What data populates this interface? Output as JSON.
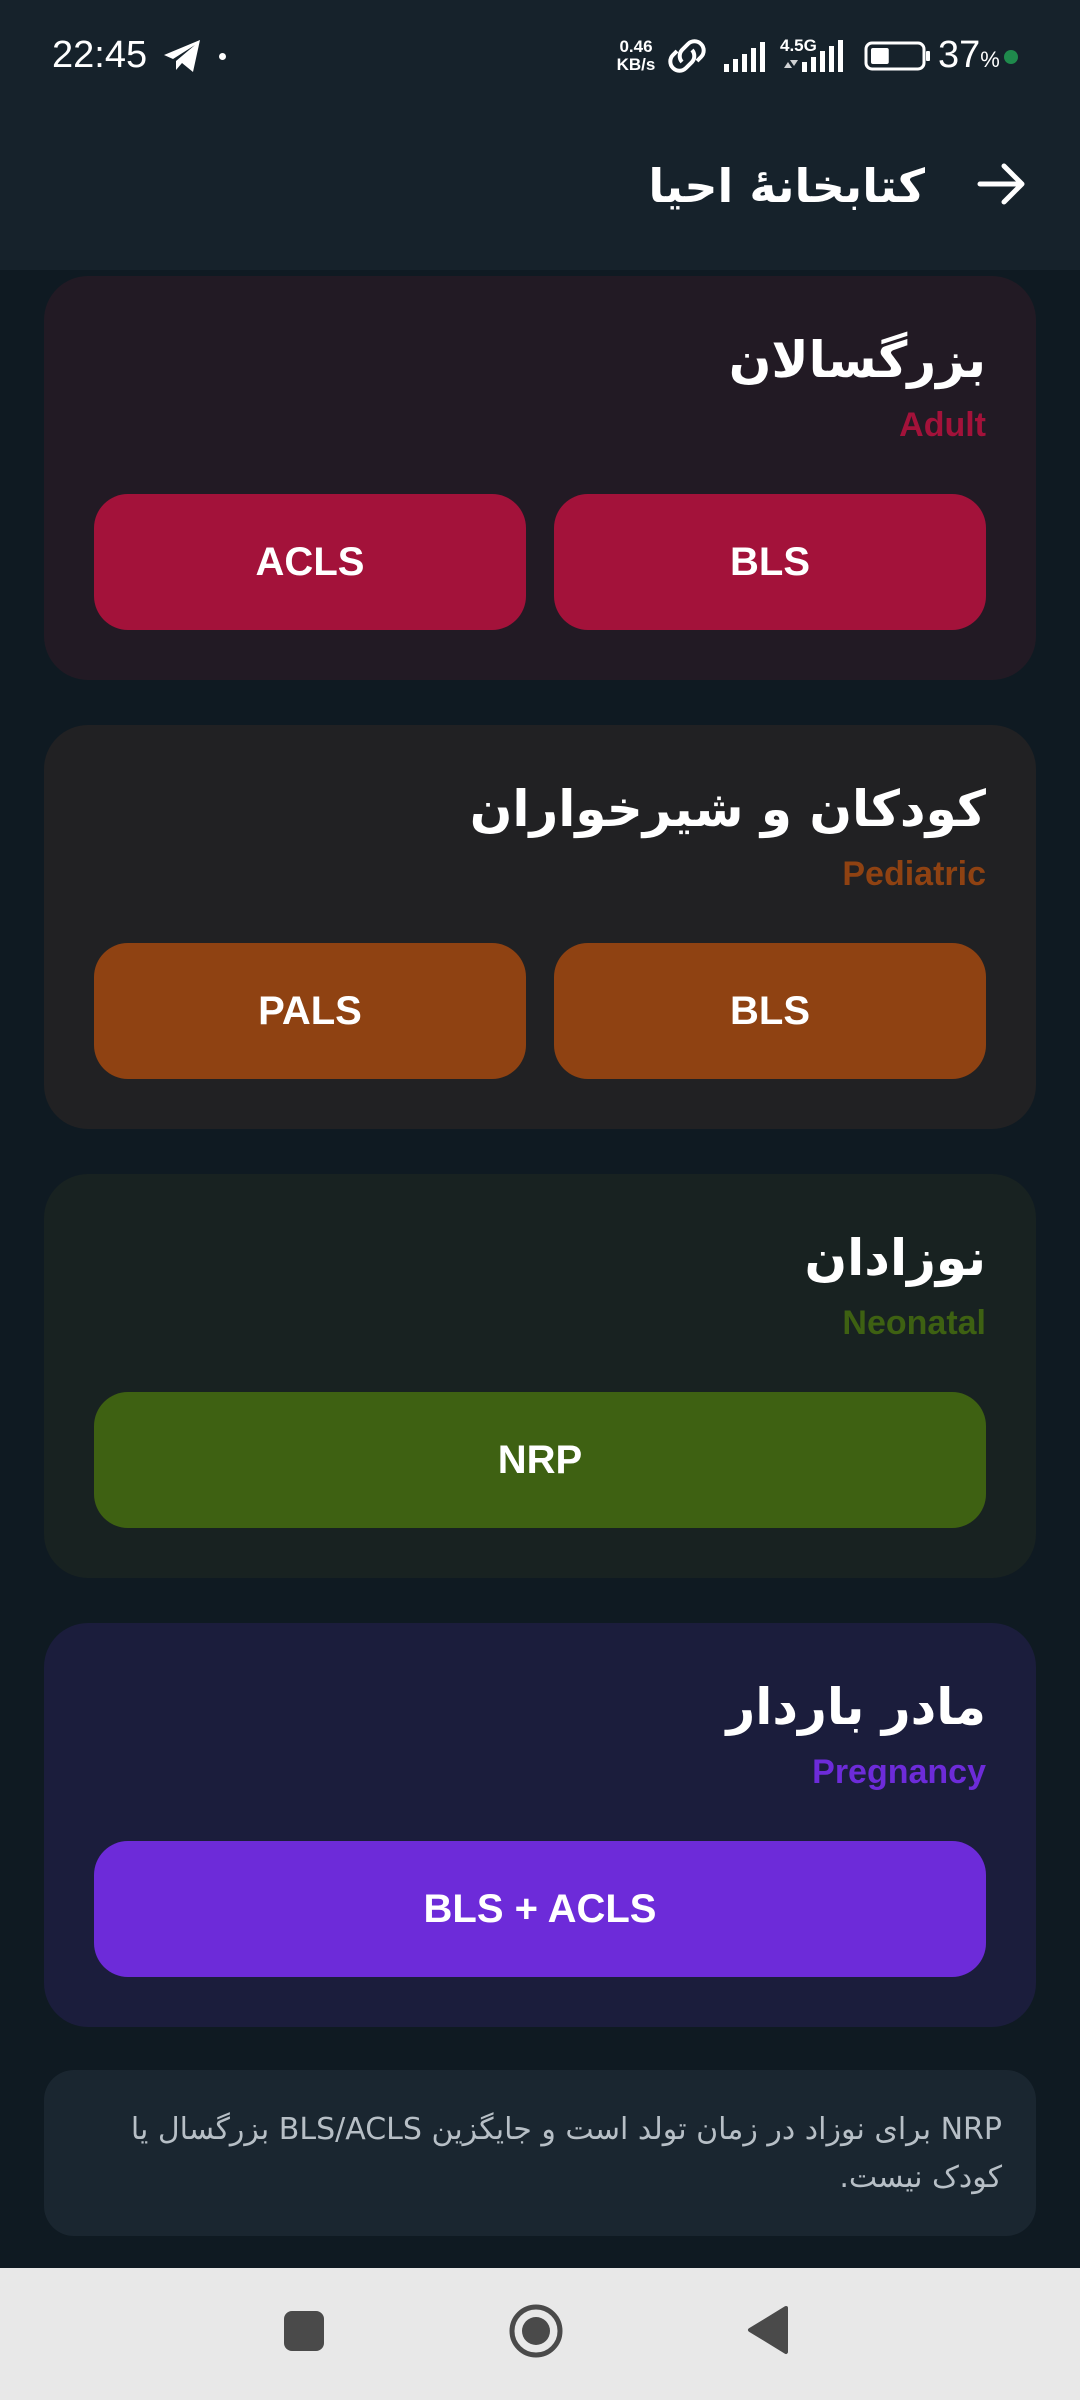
{
  "status_bar": {
    "time": "22:45",
    "speed_value": "0.46",
    "speed_unit": "KB/s",
    "network": "4.5G",
    "battery_value": "37",
    "battery_unit": "%",
    "battery_level": 0.37,
    "icons": [
      "telegram-icon",
      "link-icon",
      "signal-icon",
      "battery-icon"
    ]
  },
  "app_bar": {
    "title": "کتابخانهٔ احیا",
    "back_icon": "arrow-right-icon"
  },
  "sections": [
    {
      "title": "بزرگسالان",
      "subtitle": "Adult",
      "accent": "#a3123a",
      "card_bg": "#221a24",
      "buttons": [
        "BLS",
        "ACLS"
      ]
    },
    {
      "title": "کودکان و شیرخواران",
      "subtitle": "Pediatric",
      "accent": "#8f4212",
      "card_bg": "#212123",
      "buttons": [
        "BLS",
        "PALS"
      ]
    },
    {
      "title": "نوزادان",
      "subtitle": "Neonatal",
      "accent": "#3e6112",
      "card_bg": "#182221",
      "buttons": [
        "NRP"
      ]
    },
    {
      "title": "مادر باردار",
      "subtitle": "Pregnancy",
      "accent": "#6d2bd9",
      "card_bg": "#1b1d3c",
      "buttons": [
        "BLS + ACLS"
      ]
    }
  ],
  "note": {
    "text": "NRP برای نوزاد در زمان تولد است و جایگزین BLS/ACLS بزرگسال یا کودک نیست."
  },
  "nav_bar": {
    "icons": [
      "recents-square-icon",
      "home-circle-icon",
      "back-triangle-icon"
    ]
  }
}
